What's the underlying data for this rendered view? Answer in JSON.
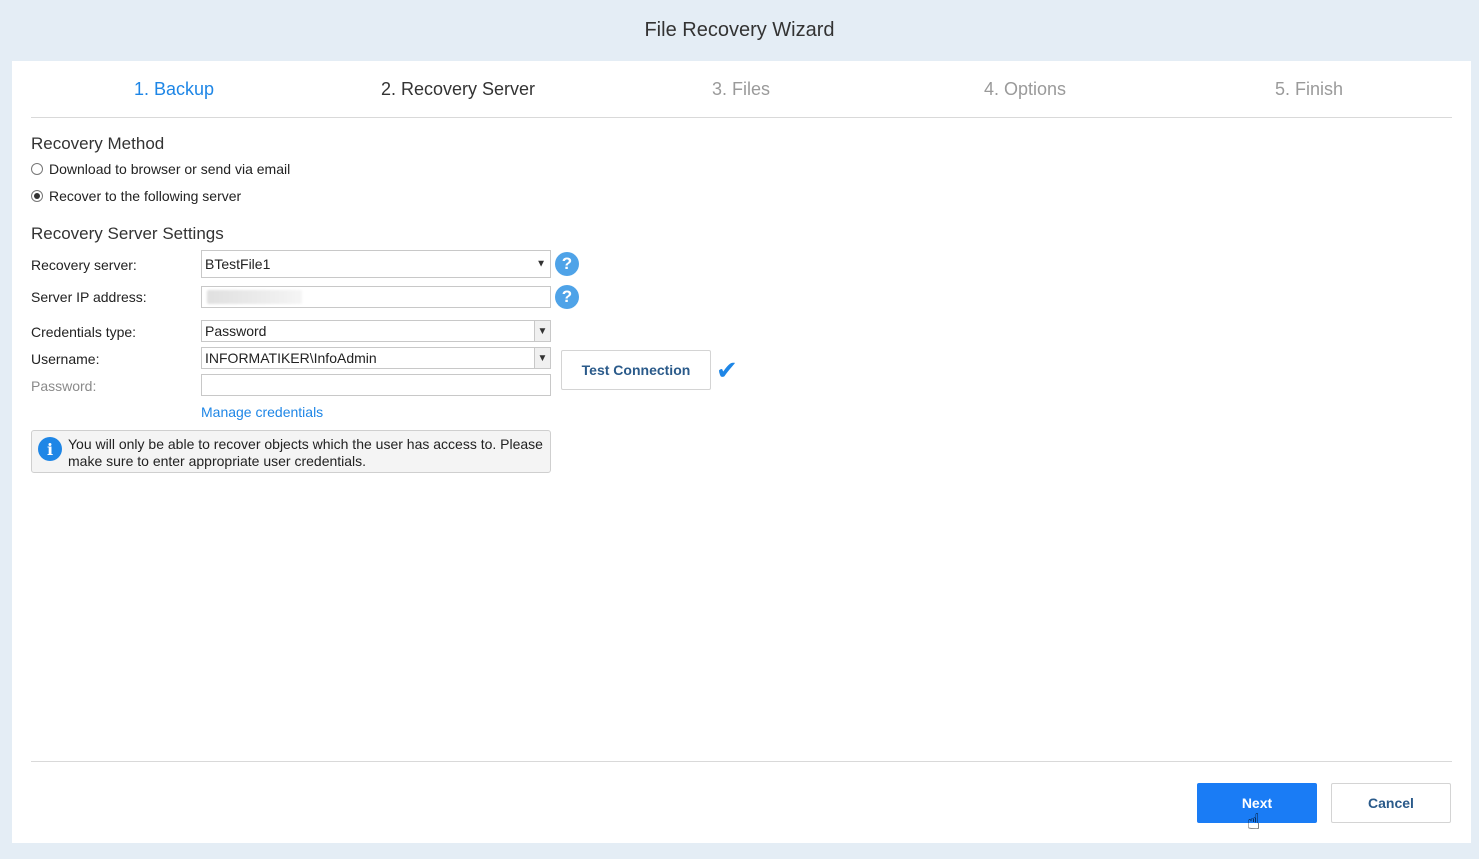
{
  "window": {
    "title": "File Recovery Wizard"
  },
  "steps": [
    {
      "label": "1. Backup",
      "state": "done"
    },
    {
      "label": "2. Recovery Server",
      "state": "current"
    },
    {
      "label": "3. Files",
      "state": "pending"
    },
    {
      "label": "4. Options",
      "state": "pending"
    },
    {
      "label": "5. Finish",
      "state": "pending"
    }
  ],
  "recovery_method": {
    "title": "Recovery Method",
    "options": [
      {
        "label": "Download to browser or send via email",
        "checked": false
      },
      {
        "label": "Recover to the following server",
        "checked": true
      }
    ]
  },
  "server_settings": {
    "title": "Recovery Server Settings",
    "recovery_server_label": "Recovery server:",
    "recovery_server_value": "BTestFile1",
    "server_ip_label": "Server IP address:",
    "server_ip_value": "",
    "credentials_type_label": "Credentials type:",
    "credentials_type_value": "Password",
    "username_label": "Username:",
    "username_value": "INFORMATIKER\\InfoAdmin",
    "password_label": "Password:",
    "password_value": "",
    "test_connection_label": "Test Connection",
    "manage_credentials_label": "Manage credentials",
    "info_text": "You will only be able to recover objects which the user has access to. Please make sure to enter appropriate user credentials."
  },
  "footer": {
    "next_label": "Next",
    "cancel_label": "Cancel"
  },
  "colors": {
    "accent": "#1e86e6",
    "primary_button": "#1a7cf5",
    "background": "#e4edf5"
  },
  "icons": {
    "help": "question-circle-icon",
    "check": "checkmark-icon",
    "info": "info-circle-icon",
    "cursor": "hand-pointer-icon"
  }
}
